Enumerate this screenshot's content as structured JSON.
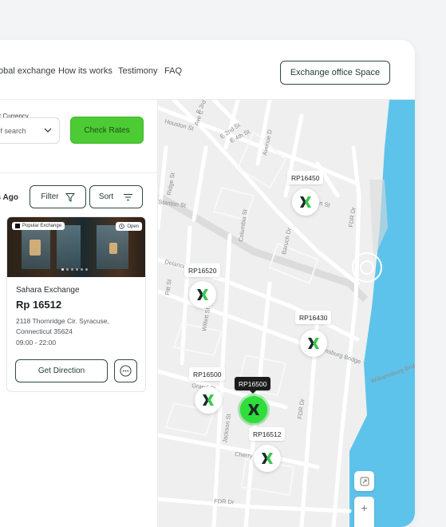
{
  "nav": {
    "links": [
      "obal exchange",
      "How its works",
      "Testimony",
      "FAQ"
    ],
    "office_button": "Exchange office Space"
  },
  "search": {
    "target_label": "get Currency",
    "currency_value": "e of search",
    "check_button": "Check Rates"
  },
  "results": {
    "ago_label": "ys Ago",
    "filter_label": "Filter",
    "sort_label": "Sort"
  },
  "card": {
    "badge_popular": "Popular Exchange",
    "badge_open": "Open",
    "name": "Sahara Exchange",
    "rate": "Rp 16512",
    "address": "2118 Thornridge Cir. Syracuse, Connecticut 35624",
    "hours": "09:00 - 22:00",
    "direction_button": "Get Direction"
  },
  "map": {
    "streets": [
      "Houston St",
      "E Houston St",
      "E 3rd St",
      "E 2nd St",
      "Ave C",
      "E 4th St",
      "Avenue D",
      "Ridge St",
      "Stanton St",
      "Columbia St",
      "Baruch Dr",
      "FDR Dr",
      "Pitt St",
      "Delancey St",
      "Williamsburg Bridge",
      "Willett St",
      "Grand St",
      "Jackson St",
      "Cherry St"
    ],
    "pins": [
      {
        "label": "RP16450",
        "active": false
      },
      {
        "label": "RP16520",
        "active": false
      },
      {
        "label": "RP16430",
        "active": false
      },
      {
        "label": "RP16500",
        "active": false
      },
      {
        "label": "RP16500",
        "active": true
      },
      {
        "label": "RP16512",
        "active": false
      }
    ],
    "zoom_in": "+",
    "zoom_out": "−"
  },
  "colors": {
    "accent": "#4ccb35",
    "pin_active": "#2fdd3b",
    "water": "#5ec3ea",
    "outline": "#2f4a40"
  }
}
